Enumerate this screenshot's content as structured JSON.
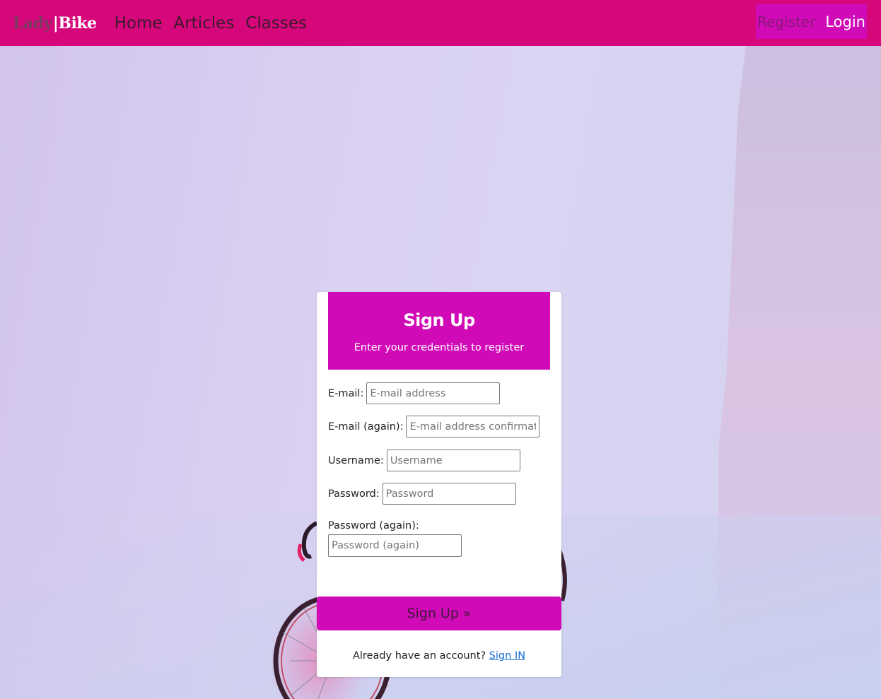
{
  "nav": {
    "brand_lady": "Lady",
    "brand_bar": "|",
    "brand_bike": "Bike",
    "links": [
      "Home",
      "Articles",
      "Classes"
    ],
    "register": "Register",
    "login": "Login"
  },
  "colors": {
    "navbar": "#d5077a",
    "accent": "#d10ab8",
    "link": "#1a6fd8"
  },
  "card": {
    "title": "Sign Up",
    "subtitle": "Enter your credentials to register",
    "fields": {
      "email": {
        "label": "E-mail:",
        "placeholder": "E-mail address"
      },
      "email2": {
        "label": "E-mail (again):",
        "placeholder": "E-mail address confirmation"
      },
      "username": {
        "label": "Username:",
        "placeholder": "Username"
      },
      "password": {
        "label": "Password:",
        "placeholder": "Password"
      },
      "password2": {
        "label": "Password (again):",
        "placeholder": "Password (again)"
      }
    },
    "submit": "Sign Up »",
    "signin_prompt": "Already have an account?",
    "signin_link": "Sign IN"
  }
}
